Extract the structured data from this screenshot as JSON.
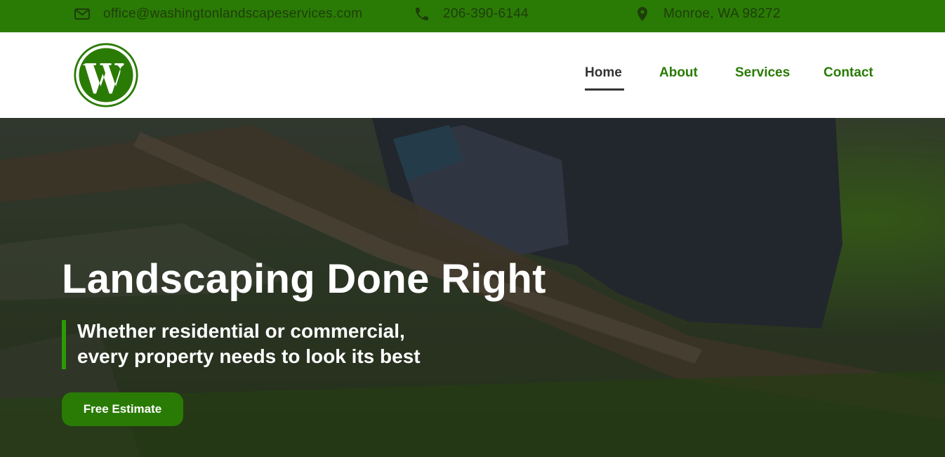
{
  "topbar": {
    "email": "office@washingtonlandscapeservices.com",
    "phone": "206-390-6144",
    "location": "Monroe, WA 98272",
    "icons": [
      "envelope-icon",
      "phone-icon",
      "map-pin-icon"
    ]
  },
  "header": {
    "logo_icon": "wordpress-logo-icon",
    "nav": {
      "home": "Home",
      "about": "About",
      "services": "Services",
      "contact": "Contact"
    }
  },
  "hero": {
    "title": "Landscaping Done Right",
    "subtitle_line1": "Whether residential or commercial,",
    "subtitle_line2": "every property needs to look its best",
    "cta_label": "Free Estimate"
  },
  "colors": {
    "brand_green": "#2a7b05",
    "nav_active": "#333333",
    "hero_text": "#ffffff"
  }
}
